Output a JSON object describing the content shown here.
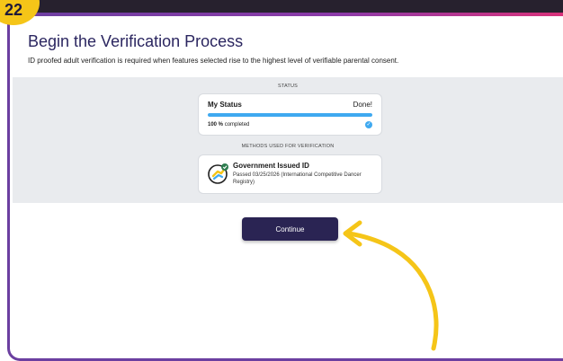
{
  "step": {
    "number": "22"
  },
  "page": {
    "title": "Begin the Verification Process",
    "subtitle": "ID proofed adult verification is required when features selected rise to the highest level of verifiable parental consent."
  },
  "status": {
    "section_label": "STATUS",
    "card_title": "My Status",
    "state": "Done!",
    "progress_percent": 100,
    "progress_value": "100 %",
    "progress_suffix": "completed"
  },
  "methods": {
    "section_label": "METHODS USED FOR VERIFICATION",
    "items": [
      {
        "name": "Government Issued ID",
        "detail": "Passed 03/25/2026 (International Competitive Dancer Registry)"
      }
    ]
  },
  "actions": {
    "continue_label": "Continue"
  },
  "colors": {
    "accent": "#2a2453",
    "progress": "#3fa9f0",
    "arrow": "#f5c518",
    "frame": "#6b3fa0"
  },
  "icons": {
    "id_icon": "id-check-icon",
    "done_icon": "check-icon",
    "annotation": "curved-arrow-icon"
  }
}
